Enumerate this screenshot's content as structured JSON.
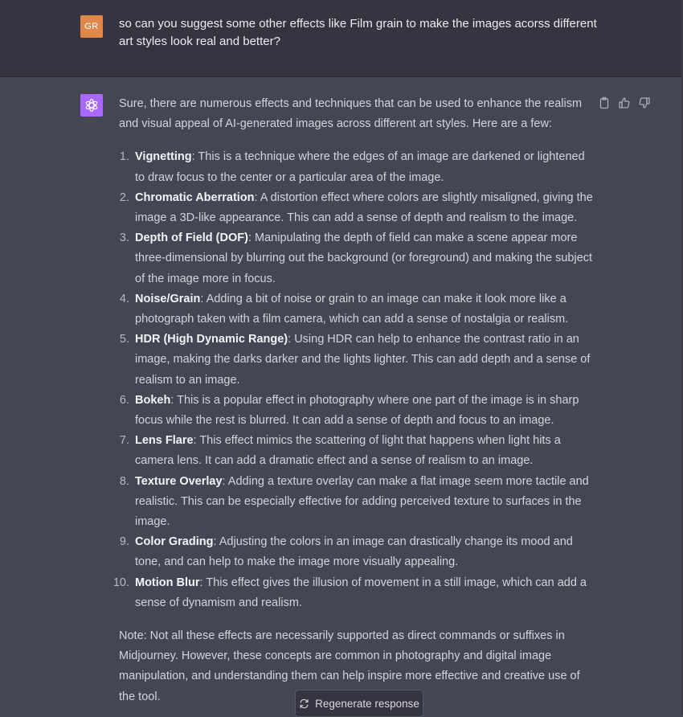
{
  "user_message": {
    "avatar_initials": "GR",
    "text": "so can you suggest some other effects like Film  grain to make the images acorss different art styles look real and better?"
  },
  "assistant_message": {
    "intro": "Sure, there are numerous effects and techniques that can be used to enhance the realism and visual appeal of AI-generated images across different art styles. Here are a few:",
    "items": [
      {
        "number": "1.",
        "title": "Vignetting",
        "text": ": This is a technique where the edges of an image are darkened or lightened to draw focus to the center or a particular area of the image."
      },
      {
        "number": "2.",
        "title": "Chromatic Aberration",
        "text": ": A distortion effect where colors are slightly misaligned, giving the image a 3D-like appearance. This can add a sense of depth and realism to the image."
      },
      {
        "number": "3.",
        "title": "Depth of Field (DOF)",
        "text": ": Manipulating the depth of field can make a scene appear more three-dimensional by blurring out the background (or foreground) and making the subject of the image more in focus."
      },
      {
        "number": "4.",
        "title": "Noise/Grain",
        "text": ": Adding a bit of noise or grain to an image can make it look more like a photograph taken with a film camera, which can add a sense of nostalgia or realism."
      },
      {
        "number": "5.",
        "title": "HDR (High Dynamic Range)",
        "text": ": Using HDR can help to enhance the contrast ratio in an image, making the darks darker and the lights lighter. This can add depth and a sense of realism to an image."
      },
      {
        "number": "6.",
        "title": "Bokeh",
        "text": ": This is a popular effect in photography where one part of the image is in sharp focus while the rest is blurred. It can add a sense of depth and focus to an image."
      },
      {
        "number": "7.",
        "title": "Lens Flare",
        "text": ": This effect mimics the scattering of light that happens when light hits a camera lens. It can add a dramatic effect and a sense of realism to an image."
      },
      {
        "number": "8.",
        "title": "Texture Overlay",
        "text": ": Adding a texture overlay can make a flat image seem more tactile and realistic. This can be especially effective for adding perceived texture to surfaces in the image."
      },
      {
        "number": "9.",
        "title": "Color Grading",
        "text": ": Adjusting the colors in an image can drastically change its mood and tone, and can help to make the image more visually appealing."
      },
      {
        "number": "10.",
        "title": "Motion Blur",
        "text": ": This effect gives the illusion of movement in a still image, which can add a sense of dynamism and realism."
      }
    ],
    "note": "Note: Not all these effects are necessarily supported as direct commands or suffixes in Midjourney. However, these concepts are common in photography and digital image manipulation, and understanding them can help inspire more effective and creative use of the tool."
  },
  "actions": {
    "copy_icon": "clipboard-icon",
    "like_icon": "thumbs-up-icon",
    "dislike_icon": "thumbs-down-icon"
  },
  "regenerate": {
    "icon": "refresh-icon",
    "label": "Regenerate response"
  },
  "colors": {
    "user_bg": "#343541",
    "assistant_bg": "#444654",
    "user_avatar": "#e0884a",
    "assistant_avatar": "#ab68ff"
  }
}
